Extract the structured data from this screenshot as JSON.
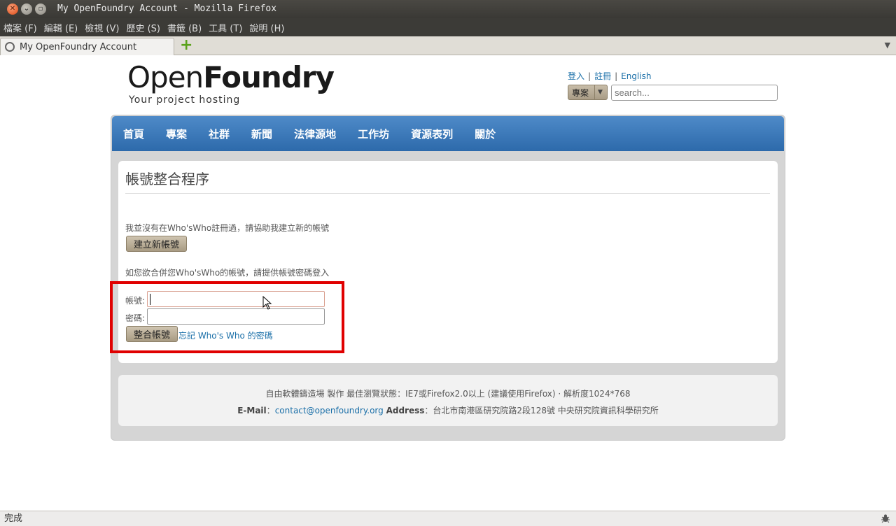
{
  "window": {
    "title": "My OpenFoundry Account - Mozilla Firefox"
  },
  "menubar": {
    "items": [
      "檔案 (F)",
      "編輯 (E)",
      "檢視 (V)",
      "歷史 (S)",
      "書籤 (B)",
      "工具 (T)",
      "說明 (H)"
    ]
  },
  "tabs": {
    "active_label": "My OpenFoundry Account",
    "new_tab_symbol": "+",
    "list_symbol": "▼"
  },
  "site": {
    "logo_open": "Open",
    "logo_foundry": "Foundry",
    "tagline": "Your project hosting",
    "links": {
      "login": "登入",
      "register": "註冊",
      "lang": "English",
      "sep": "|"
    },
    "search": {
      "category": "專案",
      "placeholder": "search..."
    },
    "nav": [
      "首頁",
      "專案",
      "社群",
      "新聞",
      "法律源地",
      "工作坊",
      "資源表列",
      "關於"
    ]
  },
  "page": {
    "title": "帳號整合程序",
    "no_account_text": "我並沒有在Who'sWho註冊過，請協助我建立新的帳號",
    "create_button": "建立新帳號",
    "merge_text": "如您欲合併您Who'sWho的帳號，請提供帳號密碼登入",
    "account_label": "帳號:",
    "password_label": "密碼:",
    "merge_button": "整合帳號",
    "forgot_link": "忘記 Who's Who 的密碼"
  },
  "footer": {
    "line1": "自由軟體鑄造場 製作 最佳瀏覽狀態：IE7或Firefox2.0以上 (建議使用Firefox) · 解析度1024*768",
    "email_label": "E-Mail",
    "email_sep": "：",
    "email": "contact@openfoundry.org",
    "address_label": "Address",
    "address_sep": "：",
    "address": "台北市南港區研究院路2段128號 中央研究院資訊科學研究所"
  },
  "statusbar": {
    "text": "完成"
  }
}
